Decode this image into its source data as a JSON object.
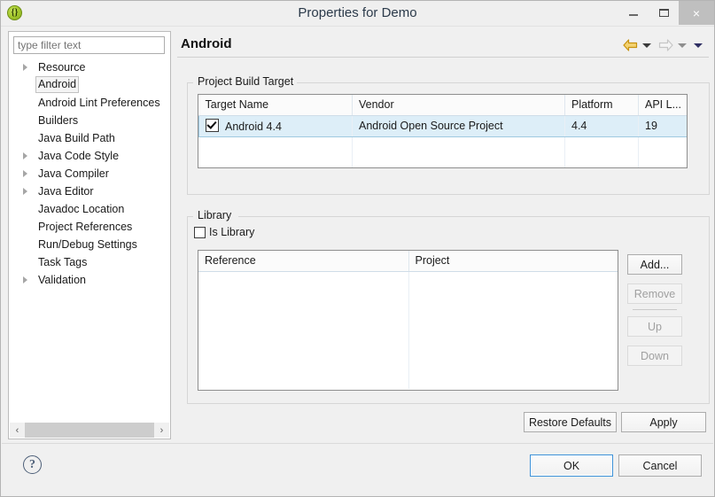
{
  "window": {
    "title": "Properties for Demo",
    "app_icon": "java-braces-icon",
    "minimize_label": "Minimize",
    "maximize_label": "Maximize",
    "close_label": "×"
  },
  "sidebar": {
    "filter_placeholder": "type filter text",
    "filter_value": "",
    "items": [
      {
        "label": "Resource",
        "expandable": true,
        "selected": false
      },
      {
        "label": "Android",
        "expandable": false,
        "selected": true
      },
      {
        "label": "Android Lint Preferences",
        "expandable": false,
        "selected": false
      },
      {
        "label": "Builders",
        "expandable": false,
        "selected": false
      },
      {
        "label": "Java Build Path",
        "expandable": false,
        "selected": false
      },
      {
        "label": "Java Code Style",
        "expandable": true,
        "selected": false
      },
      {
        "label": "Java Compiler",
        "expandable": true,
        "selected": false
      },
      {
        "label": "Java Editor",
        "expandable": true,
        "selected": false
      },
      {
        "label": "Javadoc Location",
        "expandable": false,
        "selected": false
      },
      {
        "label": "Project References",
        "expandable": false,
        "selected": false
      },
      {
        "label": "Run/Debug Settings",
        "expandable": false,
        "selected": false
      },
      {
        "label": "Task Tags",
        "expandable": false,
        "selected": false
      },
      {
        "label": "Validation",
        "expandable": true,
        "selected": false
      }
    ],
    "scroll_left_label": "‹",
    "scroll_right_label": "›"
  },
  "page": {
    "title": "Android",
    "nav": {
      "back_icon": "back-arrow-icon",
      "back_dropdown_icon": "chevron-down-icon",
      "forward_icon": "forward-arrow-icon",
      "forward_dropdown_icon": "chevron-down-icon",
      "menu_icon": "chevron-down-icon"
    }
  },
  "build_target": {
    "group_title": "Project Build Target",
    "columns": [
      "Target Name",
      "Vendor",
      "Platform",
      "API L..."
    ],
    "rows": [
      {
        "checked": true,
        "target_name": "Android 4.4",
        "vendor": "Android Open Source Project",
        "platform": "4.4",
        "api_level": "19",
        "selected": true
      }
    ]
  },
  "library": {
    "group_title": "Library",
    "is_library_label": "Is Library",
    "is_library_checked": false,
    "columns": [
      "Reference",
      "Project"
    ],
    "rows": [],
    "buttons": [
      {
        "label": "Add...",
        "enabled": true
      },
      {
        "label": "Remove",
        "enabled": false
      },
      {
        "label": "Up",
        "enabled": false
      },
      {
        "label": "Down",
        "enabled": false
      }
    ]
  },
  "footer": {
    "restore_defaults_label": "Restore Defaults",
    "apply_label": "Apply",
    "help_icon": "help-question-icon",
    "ok_label": "OK",
    "cancel_label": "Cancel"
  },
  "colors": {
    "selection_blue": "#ddeef8",
    "selection_border": "#9fc9e0",
    "focus_blue": "#3d92d8",
    "window_bg": "#f0f0f0",
    "back_arrow": "#e0a81f",
    "forward_arrow": "#cfcfcf"
  }
}
